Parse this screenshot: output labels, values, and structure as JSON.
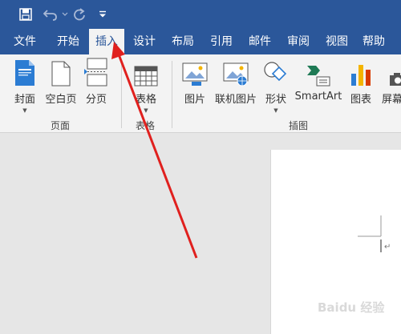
{
  "menu": {
    "tabs": [
      "文件",
      "开始",
      "插入",
      "设计",
      "布局",
      "引用",
      "邮件",
      "审阅",
      "视图",
      "帮助"
    ],
    "active": "插入"
  },
  "ribbon": {
    "page_group": {
      "label": "页面",
      "buttons": [
        "封面",
        "空白页",
        "分页"
      ]
    },
    "table_group": {
      "label": "表格",
      "buttons": [
        "表格"
      ]
    },
    "illustrations_group": {
      "label": "插图",
      "buttons": [
        "图片",
        "联机图片",
        "形状",
        "SmartArt",
        "图表",
        "屏幕"
      ]
    }
  },
  "document": {
    "paragraph_mark": "↵"
  },
  "watermark": {
    "text": "Baidu 经验"
  },
  "colors": {
    "title_blue": "#2b579a",
    "ribbon_bg": "#f3f3f3",
    "workspace_bg": "#e6e6e6",
    "arrow_red": "#e0201e"
  }
}
